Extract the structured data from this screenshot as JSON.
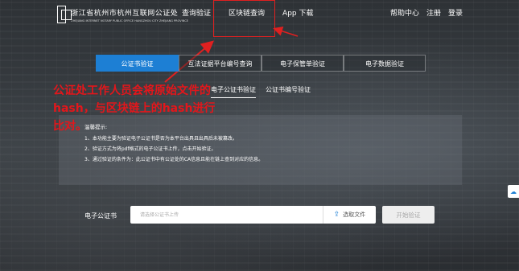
{
  "header": {
    "logo_cn": "浙江省杭州市杭州互联网公证处",
    "logo_en": "ZHEJIANG INTERNET NOTARY PUBLIC OFFICE HANGZHOU CITY ZHEJIANG PROVINCE",
    "nav": [
      "查询验证",
      "区块链查询",
      "App 下载"
    ],
    "right_links": [
      "帮助中心",
      "注册",
      "登录"
    ]
  },
  "tabs": [
    "公证书验证",
    "互法证据平台编号查询",
    "电子保管单验证",
    "电子数据验证"
  ],
  "subtabs": [
    "电子公证书验证",
    "公证书编号验证"
  ],
  "annotation": {
    "text": "公证处工作人员会将原始文件的hash，与区块链上的hash进行比对。",
    "color": "#e4161b"
  },
  "notice": {
    "title": "温馨提示:",
    "lines": [
      "1、本功能主要为验证电子公证书是否为本平台出具且出具后未被篡改。",
      "2、验证方式为将pdf格式的电子公证书上传，点击开始验证。",
      "3、通过验证的条件为：此公证书中有公证处的CA信息且能在链上查到对应的信息。"
    ]
  },
  "form": {
    "label": "电子公证书",
    "placeholder": "请选择公证书上传",
    "choose_label": "选取文件",
    "start_label": "开始验证"
  },
  "colors": {
    "accent": "#1d7fd4",
    "highlight": "#e02020"
  }
}
